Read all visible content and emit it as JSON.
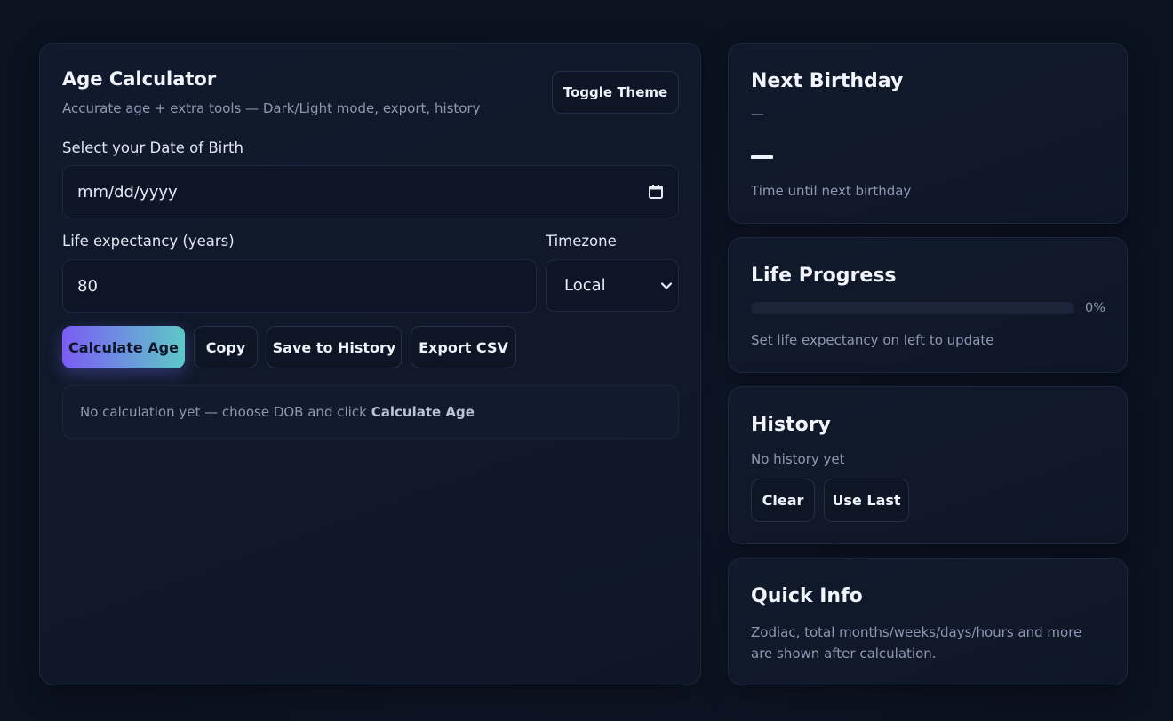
{
  "main": {
    "title": "Age Calculator",
    "subtitle": "Accurate age + extra tools — Dark/Light mode, export, history",
    "toggle_theme_label": "Toggle Theme",
    "dob_label": "Select your Date of Birth",
    "dob_placeholder": "mm/dd/yyyy",
    "life_label": "Life expectancy (years)",
    "life_value": "80",
    "timezone_label": "Timezone",
    "timezone_value": "Local",
    "buttons": {
      "calculate": "Calculate Age",
      "copy": "Copy",
      "save": "Save to History",
      "export": "Export CSV"
    },
    "result_text": "No calculation yet — choose DOB and click",
    "result_emphasis": "Calculate Age"
  },
  "next_birthday": {
    "title": "Next Birthday",
    "date_value": "—",
    "caption": "Time until next birthday"
  },
  "life_progress": {
    "title": "Life Progress",
    "percent_label": "0%",
    "percent": 0,
    "caption": "Set life expectancy on left to update"
  },
  "history": {
    "title": "History",
    "empty_text": "No history yet",
    "clear_label": "Clear",
    "use_last_label": "Use Last"
  },
  "quick_info": {
    "title": "Quick Info",
    "text": "Zodiac, total months/weeks/days/hours and more are shown after calculation."
  },
  "icons": {
    "calendar": "calendar-icon",
    "select_arrow": "chevron-down-icon"
  },
  "colors": {
    "background": "#0b1220",
    "card": "#111a2c",
    "accent_start": "#7b5cf5",
    "accent_end": "#5ec9c7",
    "muted_text": "#8d99b3"
  }
}
